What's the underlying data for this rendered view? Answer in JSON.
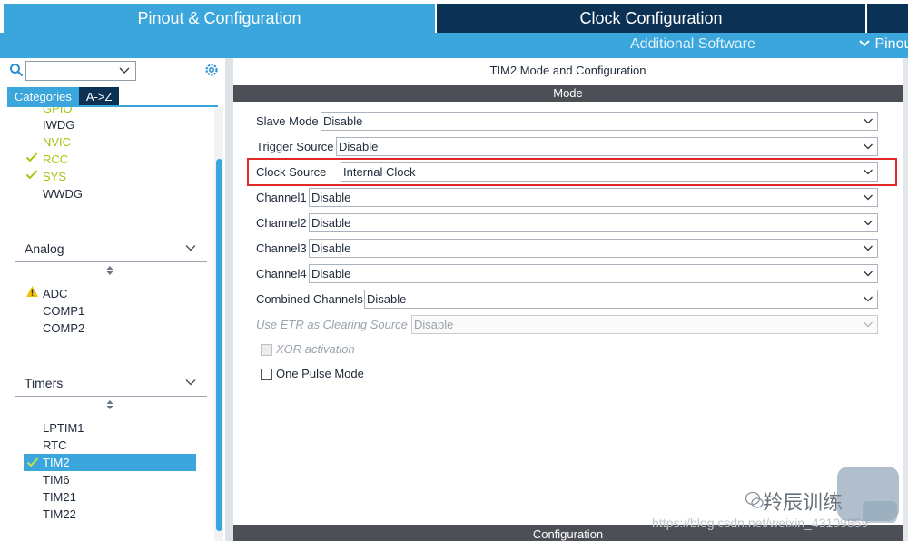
{
  "header": {
    "tabs": [
      {
        "label": "Pinout & Configuration"
      },
      {
        "label": "Clock Configuration"
      }
    ],
    "subtabs": {
      "additional_software": "Additional Software",
      "pinout": "Pinou"
    }
  },
  "sidebar": {
    "search": {
      "value": ""
    },
    "category_tabs": [
      {
        "label": "Categories"
      },
      {
        "label": "A->Z"
      }
    ],
    "system_items": [
      {
        "label": "GPIO",
        "status": "green"
      },
      {
        "label": "IWDG",
        "status": "normal"
      },
      {
        "label": "NVIC",
        "status": "green"
      },
      {
        "label": "RCC",
        "status": "checked"
      },
      {
        "label": "SYS",
        "status": "checked"
      },
      {
        "label": "WWDG",
        "status": "normal"
      }
    ],
    "analog": {
      "title": "Analog",
      "items": [
        {
          "label": "ADC",
          "status": "warning"
        },
        {
          "label": "COMP1",
          "status": "normal"
        },
        {
          "label": "COMP2",
          "status": "normal"
        }
      ]
    },
    "timers": {
      "title": "Timers",
      "items": [
        {
          "label": "LPTIM1",
          "status": "normal"
        },
        {
          "label": "RTC",
          "status": "normal"
        },
        {
          "label": "TIM2",
          "status": "selected"
        },
        {
          "label": "TIM6",
          "status": "normal"
        },
        {
          "label": "TIM21",
          "status": "normal"
        },
        {
          "label": "TIM22",
          "status": "normal"
        }
      ]
    }
  },
  "main": {
    "title": "TIM2 Mode and Configuration",
    "mode_header": "Mode",
    "fields": [
      {
        "label": "Slave Mode",
        "value": "Disable",
        "enabled": true
      },
      {
        "label": "Trigger Source",
        "value": "Disable",
        "enabled": true
      },
      {
        "label": "Clock Source",
        "value": "Internal Clock",
        "enabled": true,
        "highlighted": true
      },
      {
        "label": "Channel1",
        "value": "Disable",
        "enabled": true
      },
      {
        "label": "Channel2",
        "value": "Disable",
        "enabled": true
      },
      {
        "label": "Channel3",
        "value": "Disable",
        "enabled": true
      },
      {
        "label": "Channel4",
        "value": "Disable",
        "enabled": true
      },
      {
        "label": "Combined Channels",
        "value": "Disable",
        "enabled": true
      },
      {
        "label": "Use ETR as Clearing Source",
        "value": "Disable",
        "enabled": false
      }
    ],
    "checkboxes": [
      {
        "label": "XOR activation",
        "checked": false,
        "enabled": false
      },
      {
        "label": "One Pulse Mode",
        "checked": false,
        "enabled": true
      }
    ],
    "config_header": "Configuration"
  },
  "watermark": {
    "url": "https://blog.csdn.net/weixin_43109859",
    "brand": "羚辰训练"
  },
  "colors": {
    "accent": "#3aa6dc",
    "dark": "#0b3154",
    "green": "#a9c40f",
    "highlight": "#e02a2a",
    "bar": "#4c5056"
  }
}
